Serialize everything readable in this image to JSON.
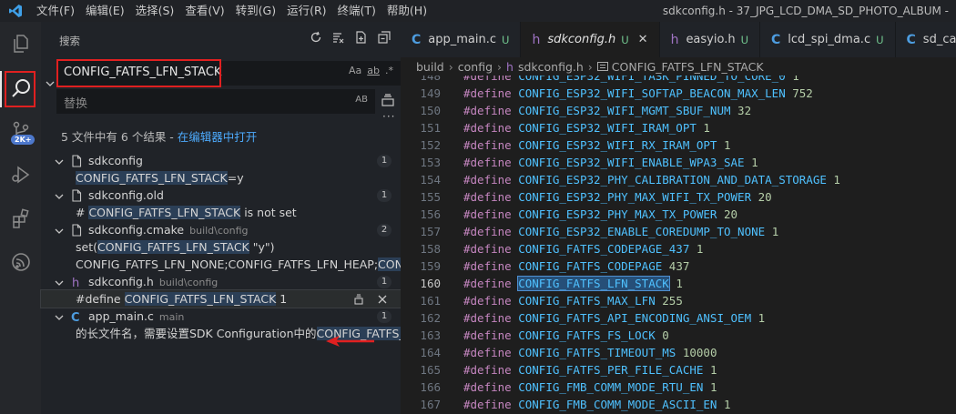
{
  "titlebar": {
    "menu": [
      "文件(F)",
      "编辑(E)",
      "选择(S)",
      "查看(V)",
      "转到(G)",
      "运行(R)",
      "终端(T)",
      "帮助(H)"
    ],
    "window_title": "sdkconfig.h - 37_JPG_LCD_DMA_SD_PHOTO_ALBUM -"
  },
  "activity": {
    "icons": [
      "explorer-icon",
      "search-icon",
      "source-control-icon",
      "run-debug-icon",
      "extensions-icon",
      "esp-idf-icon"
    ],
    "badge": "2K+"
  },
  "sidebar": {
    "title": "搜索",
    "search_value": "CONFIG_FATFS_LFN_STACK",
    "search_opts": [
      "Aa",
      "ab",
      ".*"
    ],
    "replace_placeholder": "替换",
    "replace_ab": "AB",
    "summary": "5 文件中有 6 个结果 - ",
    "summary_link": "在编辑器中打开",
    "results": [
      {
        "file": "sdkconfig",
        "path": "",
        "icon": "file-icon",
        "count": "1",
        "matches": [
          {
            "pre": "",
            "hl": "CONFIG_FATFS_LFN_STACK",
            "post": "=y"
          }
        ]
      },
      {
        "file": "sdkconfig.old",
        "path": "",
        "icon": "file-icon",
        "count": "1",
        "matches": [
          {
            "pre": "# ",
            "hl": "CONFIG_FATFS_LFN_STACK",
            "post": " is not set"
          }
        ]
      },
      {
        "file": "sdkconfig.cmake",
        "path": "build\\config",
        "icon": "file-icon",
        "count": "2",
        "matches": [
          {
            "pre": "set(",
            "hl": "CONFIG_FATFS_LFN_STACK",
            "post": " \"y\")"
          },
          {
            "pre": "CONFIG_FATFS_LFN_NONE;CONFIG_FATFS_LFN_HEAP;",
            "hl": "CONFIG_FATFS_LFN_STACK",
            "post": ""
          }
        ]
      },
      {
        "file": "sdkconfig.h",
        "path": "build\\config",
        "icon": "h-file-icon",
        "count": "1",
        "matches": [
          {
            "pre": "#define ",
            "hl": "CONFIG_FATFS_LFN_STACK",
            "post": " 1",
            "selected": true
          }
        ]
      },
      {
        "file": "app_main.c",
        "path": "main",
        "icon": "c-file-icon",
        "count": "1",
        "matches": [
          {
            "pre": "的长文件名，需要设置SDK Configuration中的",
            "hl": "CONFIG_FATFS_LFN_STACK",
            "post": ""
          }
        ]
      }
    ]
  },
  "tabs": [
    {
      "icon": "C",
      "kind": "c",
      "name": "app_main.c",
      "status": "U",
      "active": false
    },
    {
      "icon": "h",
      "kind": "h",
      "name": "sdkconfig.h",
      "status": "U",
      "active": true,
      "close": "✕"
    },
    {
      "icon": "h",
      "kind": "h",
      "name": "easyio.h",
      "status": "U",
      "active": false
    },
    {
      "icon": "C",
      "kind": "c",
      "name": "lcd_spi_dma.c",
      "status": "U",
      "active": false
    },
    {
      "icon": "C",
      "kind": "c",
      "name": "sd_ca",
      "status": "",
      "active": false
    }
  ],
  "breadcrumb": {
    "parts": [
      "build",
      "config",
      "sdkconfig.h",
      "CONFIG_FATFS_LFN_STACK"
    ]
  },
  "editor": {
    "keyword": "#define",
    "search_term": "CONFIG_FATFS_LFN_STACK",
    "current_line": "160",
    "lines": [
      {
        "n": "148",
        "macro": "CONFIG_ESP32_WIFI_TASK_PINNED_TO_CORE_0",
        "val": "1"
      },
      {
        "n": "149",
        "macro": "CONFIG_ESP32_WIFI_SOFTAP_BEACON_MAX_LEN",
        "val": "752"
      },
      {
        "n": "150",
        "macro": "CONFIG_ESP32_WIFI_MGMT_SBUF_NUM",
        "val": "32"
      },
      {
        "n": "151",
        "macro": "CONFIG_ESP32_WIFI_IRAM_OPT",
        "val": "1"
      },
      {
        "n": "152",
        "macro": "CONFIG_ESP32_WIFI_RX_IRAM_OPT",
        "val": "1"
      },
      {
        "n": "153",
        "macro": "CONFIG_ESP32_WIFI_ENABLE_WPA3_SAE",
        "val": "1"
      },
      {
        "n": "154",
        "macro": "CONFIG_ESP32_PHY_CALIBRATION_AND_DATA_STORAGE",
        "val": "1"
      },
      {
        "n": "155",
        "macro": "CONFIG_ESP32_PHY_MAX_WIFI_TX_POWER",
        "val": "20"
      },
      {
        "n": "156",
        "macro": "CONFIG_ESP32_PHY_MAX_TX_POWER",
        "val": "20"
      },
      {
        "n": "157",
        "macro": "CONFIG_ESP32_ENABLE_COREDUMP_TO_NONE",
        "val": "1"
      },
      {
        "n": "158",
        "macro": "CONFIG_FATFS_CODEPAGE_437",
        "val": "1"
      },
      {
        "n": "159",
        "macro": "CONFIG_FATFS_CODEPAGE",
        "val": "437"
      },
      {
        "n": "160",
        "macro": "CONFIG_FATFS_LFN_STACK",
        "val": "1"
      },
      {
        "n": "161",
        "macro": "CONFIG_FATFS_MAX_LFN",
        "val": "255"
      },
      {
        "n": "162",
        "macro": "CONFIG_FATFS_API_ENCODING_ANSI_OEM",
        "val": "1"
      },
      {
        "n": "163",
        "macro": "CONFIG_FATFS_FS_LOCK",
        "val": "0"
      },
      {
        "n": "164",
        "macro": "CONFIG_FATFS_TIMEOUT_MS",
        "val": "10000"
      },
      {
        "n": "165",
        "macro": "CONFIG_FATFS_PER_FILE_CACHE",
        "val": "1"
      },
      {
        "n": "166",
        "macro": "CONFIG_FMB_COMM_MODE_RTU_EN",
        "val": "1"
      },
      {
        "n": "167",
        "macro": "CONFIG_FMB_COMM_MODE_ASCII_EN",
        "val": "1"
      }
    ]
  },
  "colors": {
    "annotation_red": "#e02020",
    "accent_blue": "#4daafc",
    "untracked_green": "#73c991"
  }
}
